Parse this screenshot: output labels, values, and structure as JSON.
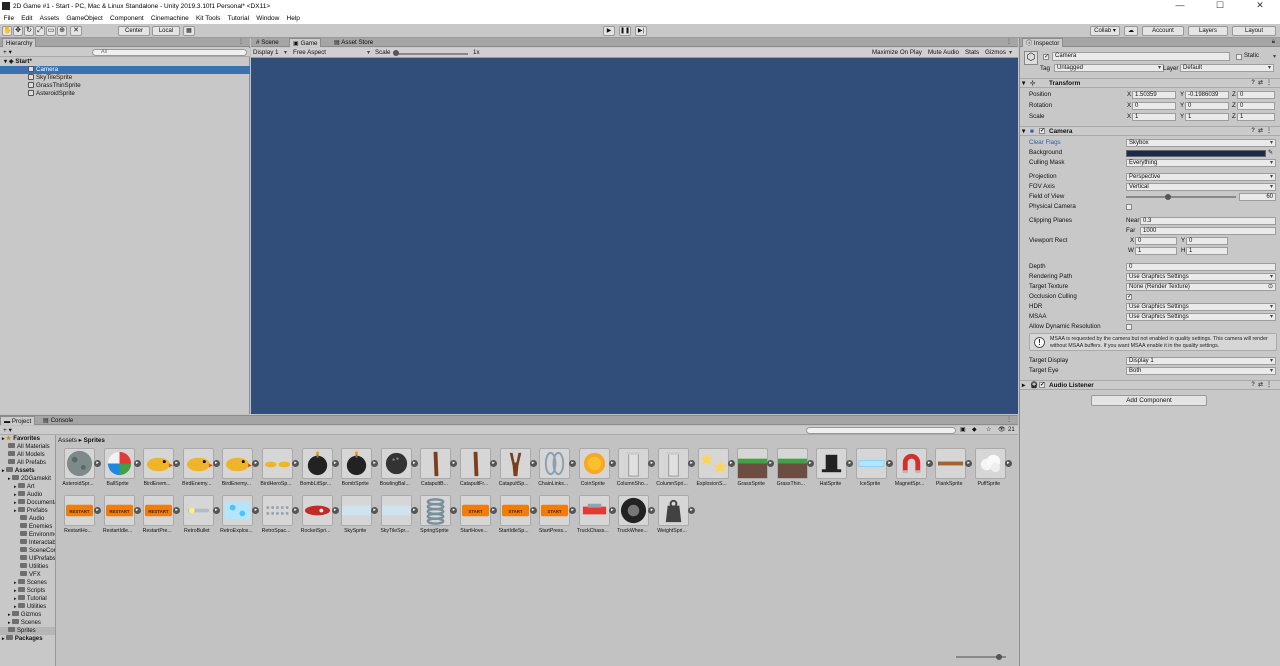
{
  "window": {
    "title": "2D Game #1 - Start - PC, Mac & Linux Standalone - Unity 2019.3.10f1 Personal* <DX11>",
    "controls": [
      "—",
      "☐",
      "✕"
    ]
  },
  "menu": [
    "File",
    "Edit",
    "Assets",
    "GameObject",
    "Component",
    "Cinemachine",
    "Kit Tools",
    "Tutorial",
    "Window",
    "Help"
  ],
  "toolbar": {
    "center": "Center",
    "local": "Local",
    "collab": "Collab ▾",
    "account": "Account",
    "layers": "Layers",
    "layout": "Layout"
  },
  "hierarchy": {
    "tab": "Hierarchy",
    "add": "+ ▾",
    "search_placeholder": "All",
    "scene": "Start*",
    "items": [
      "Camera",
      "SkyTileSprite",
      "GrassThinSprite",
      "AsteroidSprite"
    ]
  },
  "view": {
    "tabs": [
      "Scene",
      "Game",
      "Asset Store"
    ],
    "display": "Display 1",
    "aspect": "Free Aspect",
    "scale_label": "Scale",
    "scale_value": "1x",
    "maximize": "Maximize On Play",
    "mute": "Mute Audio",
    "stats": "Stats",
    "gizmos": "Gizmos",
    "bg_color": "#314d79"
  },
  "inspector": {
    "tab": "Inspector",
    "object_name": "Camera",
    "static": "Static",
    "tag_label": "Tag",
    "tag": "Untagged",
    "layer_label": "Layer",
    "layer": "Default",
    "transform": {
      "header": "Transform",
      "position_label": "Position",
      "position": [
        "1.50359",
        "-0.1986039",
        "0"
      ],
      "rotation_label": "Rotation",
      "rotation": [
        "0",
        "0",
        "0"
      ],
      "scale_label": "Scale",
      "scale": [
        "1",
        "1",
        "1"
      ],
      "axes": [
        "X",
        "Y",
        "Z"
      ]
    },
    "camera": {
      "header": "Camera",
      "clear_flags_label": "Clear Flags",
      "clear_flags": "Skybox",
      "background_label": "Background",
      "background_color": "#1b2a4a",
      "culling_mask_label": "Culling Mask",
      "culling_mask": "Everything",
      "projection_label": "Projection",
      "projection": "Perspective",
      "fov_axis_label": "FOV Axis",
      "fov_axis": "Vertical",
      "fov_label": "Field of View",
      "fov": "60",
      "physical_label": "Physical Camera",
      "clipping_label": "Clipping Planes",
      "near_label": "Near",
      "near": "0.3",
      "far_label": "Far",
      "far": "1000",
      "viewport_label": "Viewport Rect",
      "vx_label": "X",
      "vx": "0",
      "vy_label": "Y",
      "vy": "0",
      "vw_label": "W",
      "vw": "1",
      "vh_label": "H",
      "vh": "1",
      "depth_label": "Depth",
      "depth": "0",
      "rendering_path_label": "Rendering Path",
      "rendering_path": "Use Graphics Settings",
      "target_texture_label": "Target Texture",
      "target_texture": "None (Render Texture)",
      "occlusion_label": "Occlusion Culling",
      "hdr_label": "HDR",
      "hdr": "Use Graphics Settings",
      "msaa_label": "MSAA",
      "msaa": "Use Graphics Settings",
      "dynres_label": "Allow Dynamic Resolution",
      "help": "MSAA is requested by the camera but not enabled in quality settings. This camera will render without MSAA buffers. If you want MSAA enable it in the quality settings.",
      "target_display_label": "Target Display",
      "target_display": "Display 1",
      "target_eye_label": "Target Eye",
      "target_eye": "Both"
    },
    "audio": {
      "header": "Audio Listener"
    },
    "add_component": "Add Component"
  },
  "project": {
    "tabs": [
      "Project",
      "Console"
    ],
    "add": "+ ▾",
    "item_count": "21",
    "tree": [
      {
        "label": "Favorites",
        "bold": true,
        "indent": 0
      },
      {
        "label": "All Materials",
        "indent": 1
      },
      {
        "label": "All Models",
        "indent": 1
      },
      {
        "label": "All Prefabs",
        "indent": 1
      },
      {
        "label": "Assets",
        "bold": true,
        "indent": 0
      },
      {
        "label": "2DGamekit",
        "indent": 1
      },
      {
        "label": "Art",
        "indent": 2
      },
      {
        "label": "Audio",
        "indent": 2
      },
      {
        "label": "Documentation",
        "indent": 2
      },
      {
        "label": "Prefabs",
        "indent": 2
      },
      {
        "label": "Audio",
        "indent": 3
      },
      {
        "label": "Enemies",
        "indent": 3
      },
      {
        "label": "Environment",
        "indent": 3
      },
      {
        "label": "Interactables",
        "indent": 3
      },
      {
        "label": "SceneControl",
        "indent": 3
      },
      {
        "label": "UIPrefabs",
        "indent": 3
      },
      {
        "label": "Utilities",
        "indent": 3
      },
      {
        "label": "VFX",
        "indent": 3
      },
      {
        "label": "Scenes",
        "indent": 2
      },
      {
        "label": "Scripts",
        "indent": 2
      },
      {
        "label": "Tutorial",
        "indent": 2
      },
      {
        "label": "Utilities",
        "indent": 2
      },
      {
        "label": "Gizmos",
        "indent": 1
      },
      {
        "label": "Scenes",
        "indent": 1
      },
      {
        "label": "Sprites",
        "indent": 1,
        "selected": true
      },
      {
        "label": "Packages",
        "bold": true,
        "indent": 0
      }
    ],
    "breadcrumb": [
      "Assets",
      "Sprites"
    ],
    "assets_row1": [
      {
        "name": "AsteroidSpr...",
        "icon": "asteroid"
      },
      {
        "name": "BallSprite",
        "icon": "ball"
      },
      {
        "name": "BirdEnem...",
        "icon": "bird"
      },
      {
        "name": "BirdEnemy...",
        "icon": "bird"
      },
      {
        "name": "BirdEnemy...",
        "icon": "bird"
      },
      {
        "name": "BirdHeroSp...",
        "icon": "birds"
      },
      {
        "name": "BombLitSpr...",
        "icon": "bomb"
      },
      {
        "name": "BombSprite",
        "icon": "bomb"
      },
      {
        "name": "BowlingBal...",
        "icon": "bowling"
      },
      {
        "name": "CatapultB...",
        "icon": "stick"
      },
      {
        "name": "CatapultFr...",
        "icon": "stick"
      },
      {
        "name": "CatapultSp...",
        "icon": "fork"
      },
      {
        "name": "ChainLinks...",
        "icon": "chain"
      },
      {
        "name": "CoinSprite",
        "icon": "coin"
      },
      {
        "name": "ColumnSho...",
        "icon": "column"
      },
      {
        "name": "ColumnSpri...",
        "icon": "column"
      },
      {
        "name": "ExplosionS...",
        "icon": "explosion"
      },
      {
        "name": "GrassSprite",
        "icon": "grass"
      },
      {
        "name": "GrassThin...",
        "icon": "grass"
      },
      {
        "name": "HatSprite",
        "icon": "hat"
      },
      {
        "name": "IceSprite",
        "icon": "ice"
      },
      {
        "name": "MagnetSpr...",
        "icon": "magnet"
      },
      {
        "name": "PlankSprite",
        "icon": "plank"
      },
      {
        "name": "PuffSprite",
        "icon": "puff"
      }
    ],
    "assets_row2": [
      {
        "name": "RestartHo...",
        "icon": "restart",
        "text": "RESTART"
      },
      {
        "name": "RestartIdle...",
        "icon": "restart",
        "text": "RESTART"
      },
      {
        "name": "RestartPre...",
        "icon": "restart",
        "text": "RESTART"
      },
      {
        "name": "RetroBullet",
        "icon": "bullet"
      },
      {
        "name": "RetroExplos...",
        "icon": "retroexp"
      },
      {
        "name": "RetroSpac...",
        "icon": "dots"
      },
      {
        "name": "RocketSpri...",
        "icon": "rocket"
      },
      {
        "name": "SkySprite",
        "icon": "sky"
      },
      {
        "name": "SkyTileSpr...",
        "icon": "sky"
      },
      {
        "name": "SpringSprite",
        "icon": "spring"
      },
      {
        "name": "StartHove...",
        "icon": "start",
        "text": "START"
      },
      {
        "name": "StartIdleSp...",
        "icon": "start",
        "text": "START"
      },
      {
        "name": "StartPress...",
        "icon": "start",
        "text": "START"
      },
      {
        "name": "TruckChass...",
        "icon": "truck"
      },
      {
        "name": "TruckWhee...",
        "icon": "wheel"
      },
      {
        "name": "WeightSpri...",
        "icon": "weight"
      }
    ]
  }
}
